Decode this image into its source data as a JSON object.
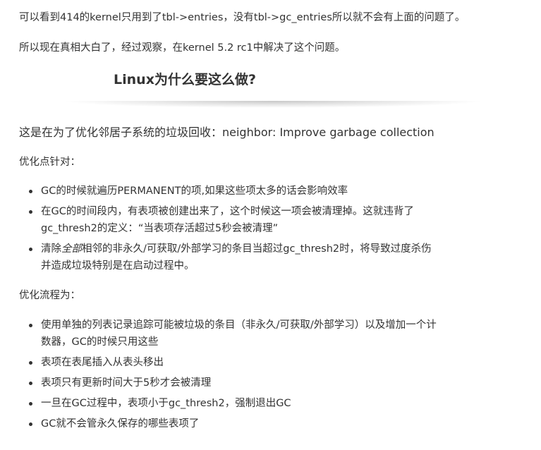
{
  "paragraphs": {
    "p1": "可以看到414的kernel只用到了tbl->entries，没有tbl->gc_entries所以就不会有上面的问题了。",
    "p2": "所以现在真相大白了，经过观察，在kernel 5.2 rc1中解决了这个问题。",
    "p3": "这是在为了优化邻居子系统的垃圾回收：neighbor: Improve garbage collection",
    "p4": "优化点针对：",
    "p5": "优化流程为："
  },
  "heading": "Linux为什么要这么做?",
  "list1": {
    "item1": "GC的时候就遍历PERMANENT的项,如果这些项太多的话会影响效率",
    "item2_line1": "在GC的时间段内，有表项被创建出来了，这个时候这一项会被清理掉。这就违背了",
    "item2_line2": "gc_thresh2的定义：“当表项存活超过5秒会被清理”",
    "item3_pre": "清除",
    "item3_em": "全部",
    "item3_line1_rest": "相邻的非永久/可获取/外部学习的条目当超过gc_thresh2时，将导致过度杀伤",
    "item3_line2": "并造成垃圾特别是在启动过程中。"
  },
  "list2": {
    "item1_line1": "使用单独的列表记录追踪可能被垃圾的条目（非永久/可获取/外部学习）以及增加一个计",
    "item1_line2": "数器，GC的时候只用这些",
    "item2": "表项在表尾插入从表头移出",
    "item3": "表项只有更新时间大于5秒才会被清理",
    "item4": "一旦在GC过程中，表项小于gc_thresh2，强制退出GC",
    "item5": "GC就不会管永久保存的哪些表项了"
  }
}
